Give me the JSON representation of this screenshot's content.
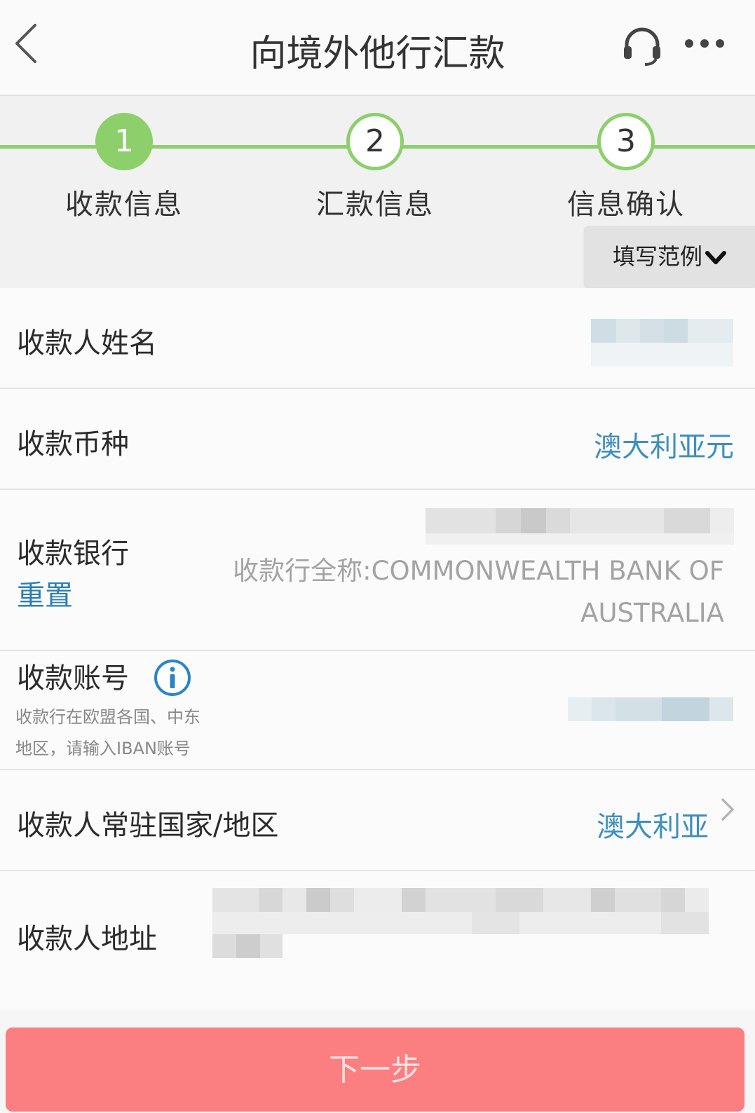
{
  "header": {
    "title": "向境外他行汇款",
    "back_icon": "chevron-left-icon",
    "service_icon": "headset-icon",
    "more_icon": "more-dots-icon"
  },
  "steps": [
    {
      "number": "1",
      "label": "收款信息",
      "active": true
    },
    {
      "number": "2",
      "label": "汇款信息",
      "active": false
    },
    {
      "number": "3",
      "label": "信息确认",
      "active": false
    }
  ],
  "example_button": "填写范例",
  "form": {
    "payee_name": {
      "label": "收款人姓名"
    },
    "currency": {
      "label": "收款币种",
      "value": "澳大利亚元"
    },
    "bank": {
      "label": "收款银行",
      "reset": "重置",
      "placeholder": "收款行全称:COMMONWEALTH BANK OF AUSTRALIA"
    },
    "account": {
      "label": "收款账号",
      "hint_line1": "收款行在欧盟各国、中东",
      "hint_line2": "地区，请输入IBAN账号"
    },
    "country": {
      "label": "收款人常驻国家/地区",
      "value": "澳大利亚"
    },
    "address": {
      "label": "收款人地址"
    }
  },
  "next_button": "下一步",
  "colors": {
    "accent_green": "#8ccf6b",
    "link_blue": "#3d8fbe",
    "button_red": "#fb7e80"
  }
}
